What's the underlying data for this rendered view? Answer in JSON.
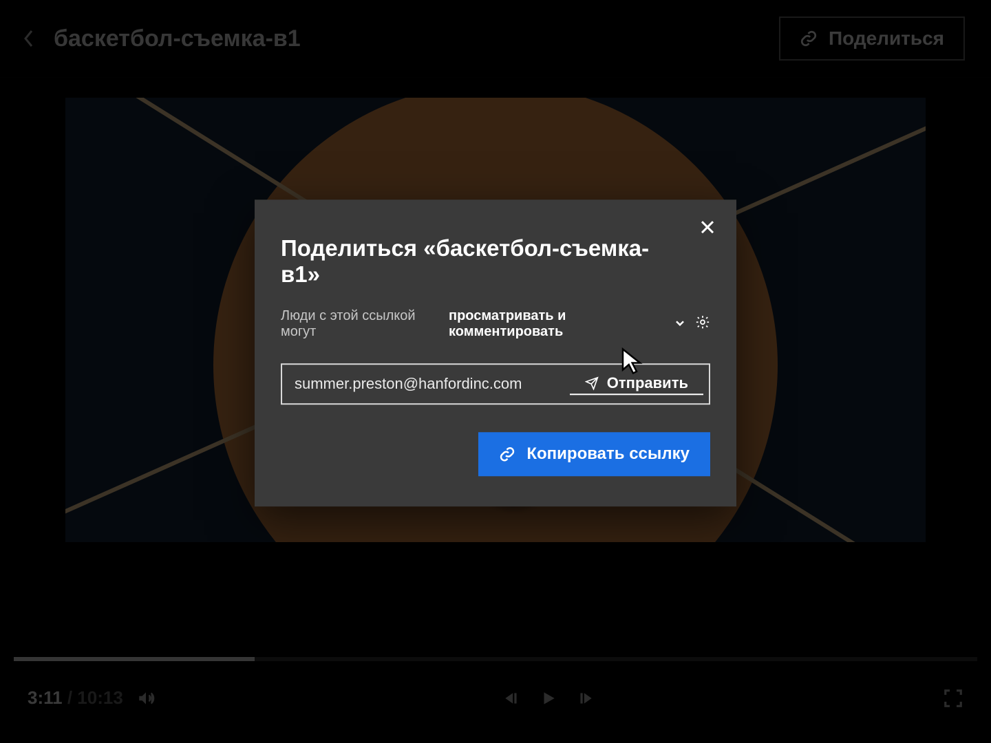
{
  "header": {
    "title": "баскетбол-съемка-в1",
    "share_label": "Поделиться"
  },
  "player": {
    "elapsed": "3:11",
    "total": "10:13",
    "progress_percent": 25
  },
  "modal": {
    "title": "Поделиться «баскетбол-съемка-в1»",
    "permission_prefix": "Люди с этой ссылкой могут",
    "permission_value": "просматривать и комментировать",
    "email_value": "summer.preston@hanfordinc.com",
    "email_placeholder": "",
    "send_label": "Отправить",
    "copy_link_label": "Копировать ссылку"
  }
}
